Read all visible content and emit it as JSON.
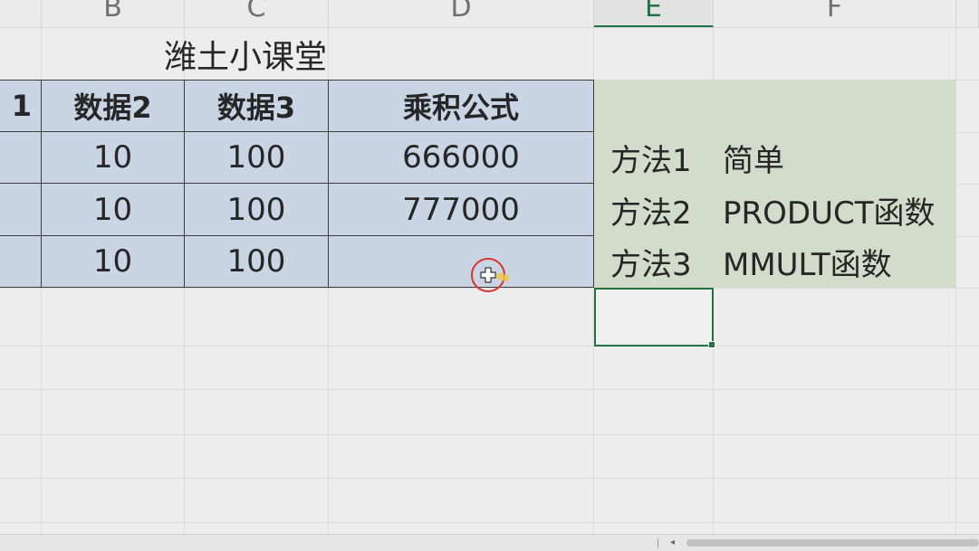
{
  "columns": [
    "B",
    "C",
    "D",
    "E",
    "F"
  ],
  "title": "潍土小课堂",
  "table": {
    "headers": [
      "1",
      "数据2",
      "数据3",
      "乘积公式"
    ],
    "rows": [
      [
        "",
        "10",
        "100",
        "666000"
      ],
      [
        "",
        "10",
        "100",
        "777000"
      ],
      [
        "",
        "10",
        "100",
        ""
      ]
    ]
  },
  "methods": [
    {
      "name": "方法1",
      "desc": "简单"
    },
    {
      "name": "方法2",
      "desc": "PRODUCT函数"
    },
    {
      "name": "方法3",
      "desc": "MMULT函数"
    }
  ],
  "colors": {
    "table_fill": "#c9d4e4",
    "note_fill": "#d3dcca",
    "selection": "#217346",
    "cursor_ring": "#d9342b"
  }
}
